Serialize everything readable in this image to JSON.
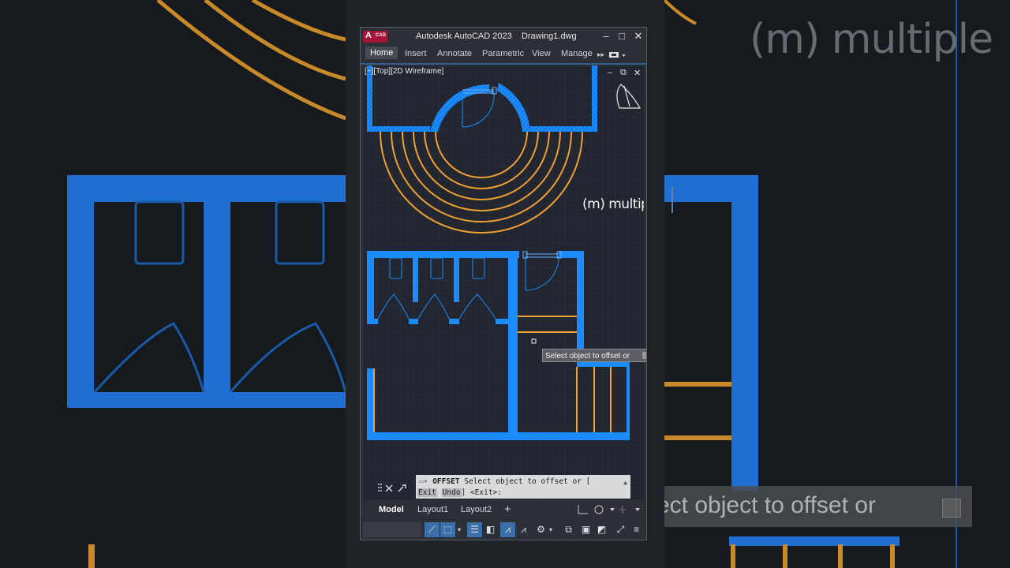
{
  "background": {
    "watermark_text": "(m) multiple",
    "prompt_text": "ect object to offset or"
  },
  "titlebar": {
    "app_title": "Autodesk AutoCAD 2023",
    "file_name": "Drawing1.dwg",
    "logo_letter": "A",
    "logo_sub": "CAD",
    "minimize": "–",
    "maximize": "□",
    "close": "✕"
  },
  "ribbon": {
    "tabs": [
      "Home",
      "Insert",
      "Annotate",
      "Parametric",
      "View",
      "Manage"
    ],
    "active": "Home",
    "more": "▸▸"
  },
  "viewport": {
    "label": "[−][Top][2D Wireframe]",
    "overlay_text": "(m) multiple",
    "controls": {
      "min": "–",
      "restore": "⧉",
      "close": "✕"
    }
  },
  "tooltip": {
    "text": "Select object to offset or"
  },
  "command_line": {
    "command": "OFFSET",
    "prompt_line1": "Select object to offset or [",
    "option1": "Exit",
    "option2": "Undo",
    "prompt_line2_end": "] <Exit>:"
  },
  "layout_tabs": {
    "items": [
      "Model",
      "Layout1",
      "Layout2"
    ],
    "add": "+"
  },
  "colors": {
    "wall_blue": "#1a8cff",
    "offset_orange": "#f0a030",
    "viewport_bg": "#222630",
    "chrome": "#2c3036",
    "logo_red": "#a3163a"
  }
}
